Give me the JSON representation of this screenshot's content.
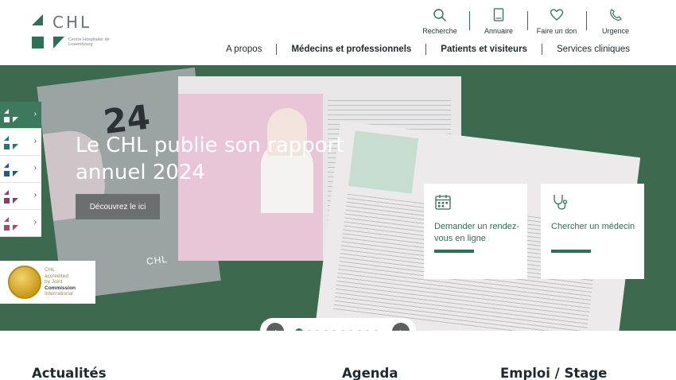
{
  "brand": {
    "name": "CHL",
    "subtitle": "Centre Hospitalier de Luxembourg",
    "colors": {
      "primary": "#2f6f55",
      "hero_bg": "#3d6a4e",
      "pink": "#a05a7d"
    }
  },
  "utility_nav": [
    {
      "label": "Recherche",
      "icon": "search-icon"
    },
    {
      "label": "Annuaire",
      "icon": "phone-book-icon"
    },
    {
      "label": "Faire un don",
      "icon": "heart-icon"
    },
    {
      "label": "Urgence",
      "icon": "phone-icon"
    }
  ],
  "main_nav": [
    {
      "label": "A propos"
    },
    {
      "label": "Médecins et professionnels"
    },
    {
      "label": "Patients et visiteurs"
    },
    {
      "label": "Services cliniques"
    }
  ],
  "hero": {
    "title": "Le CHL publie son rapport annuel 2024",
    "button": "Découvrez le ici",
    "report_year": "24",
    "report_logo": "CHL"
  },
  "quick_actions": [
    {
      "label": "Demander un rendez-vous en ligne",
      "icon": "calendar-icon"
    },
    {
      "label": "Chercher un médecin",
      "icon": "stethoscope-icon"
    }
  ],
  "side_tabs": [
    {
      "color": "#ffffff",
      "active": true
    },
    {
      "color": "#1d7a7a",
      "active": false
    },
    {
      "color": "#1d5c8a",
      "active": false
    },
    {
      "color": "#8a3b6e",
      "active": false
    },
    {
      "color": "#a64a6a",
      "active": false
    }
  ],
  "accreditation": {
    "line1": "CHL",
    "line2": "accredited",
    "line3": "by Joint",
    "line4": "Commission",
    "line5": "International"
  },
  "carousel": {
    "slides": 10,
    "active": 0
  },
  "sections": [
    {
      "title": "Actualités"
    },
    {
      "title": "Agenda"
    },
    {
      "title": "Emploi / Stage"
    }
  ]
}
